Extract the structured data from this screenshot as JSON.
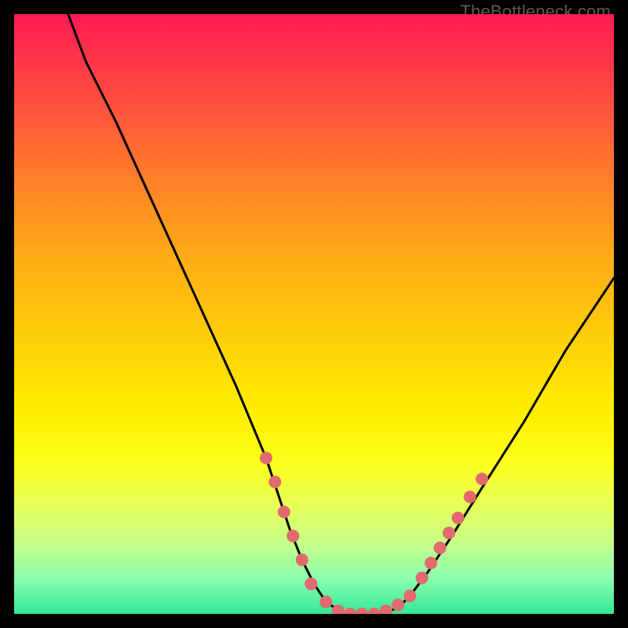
{
  "watermark": {
    "text": "TheBottleneck.com"
  },
  "chart_data": {
    "type": "line",
    "title": "",
    "xlabel": "",
    "ylabel": "",
    "xlim": [
      0,
      100
    ],
    "ylim": [
      0,
      100
    ],
    "gradient_stops_pct": [
      {
        "pct": 0,
        "color": "#ff1a54"
      },
      {
        "pct": 10,
        "color": "#ff3e46"
      },
      {
        "pct": 22,
        "color": "#ff6a32"
      },
      {
        "pct": 32,
        "color": "#ff8f22"
      },
      {
        "pct": 42,
        "color": "#ffb015"
      },
      {
        "pct": 55,
        "color": "#ffd108"
      },
      {
        "pct": 67,
        "color": "#fff000"
      },
      {
        "pct": 75,
        "color": "#fbff1e"
      },
      {
        "pct": 82,
        "color": "#e6ff5a"
      },
      {
        "pct": 88,
        "color": "#c8ff86"
      },
      {
        "pct": 94,
        "color": "#8dffb0"
      },
      {
        "pct": 100,
        "color": "#33e796"
      }
    ],
    "series": [
      {
        "name": "curve",
        "color": "#000000",
        "x": [
          9,
          12,
          17,
          22,
          27,
          32,
          37,
          42,
          44,
          46,
          48,
          50,
          52,
          55,
          58,
          61,
          64,
          66,
          69,
          73,
          78,
          85,
          92,
          100
        ],
        "y": [
          100,
          92,
          82,
          71,
          60,
          49,
          38,
          26,
          20,
          14,
          9,
          5,
          2,
          0,
          0,
          0,
          1,
          3,
          7,
          13,
          21,
          32,
          44,
          56
        ]
      }
    ],
    "markers": {
      "name": "dots",
      "color": "#e16a6d",
      "radius_px": 8,
      "points": [
        {
          "x": 42,
          "y": 26
        },
        {
          "x": 43.5,
          "y": 22
        },
        {
          "x": 45,
          "y": 17
        },
        {
          "x": 46.5,
          "y": 13
        },
        {
          "x": 48,
          "y": 9
        },
        {
          "x": 49.5,
          "y": 5
        },
        {
          "x": 52,
          "y": 2
        },
        {
          "x": 54,
          "y": 0.5
        },
        {
          "x": 56,
          "y": 0
        },
        {
          "x": 58,
          "y": 0
        },
        {
          "x": 60,
          "y": 0
        },
        {
          "x": 62,
          "y": 0.5
        },
        {
          "x": 64,
          "y": 1.5
        },
        {
          "x": 66,
          "y": 3
        },
        {
          "x": 68,
          "y": 6
        },
        {
          "x": 69.5,
          "y": 8.5
        },
        {
          "x": 71,
          "y": 11
        },
        {
          "x": 72.5,
          "y": 13.5
        },
        {
          "x": 74,
          "y": 16
        },
        {
          "x": 76,
          "y": 19.5
        },
        {
          "x": 78,
          "y": 22.5
        }
      ]
    }
  }
}
